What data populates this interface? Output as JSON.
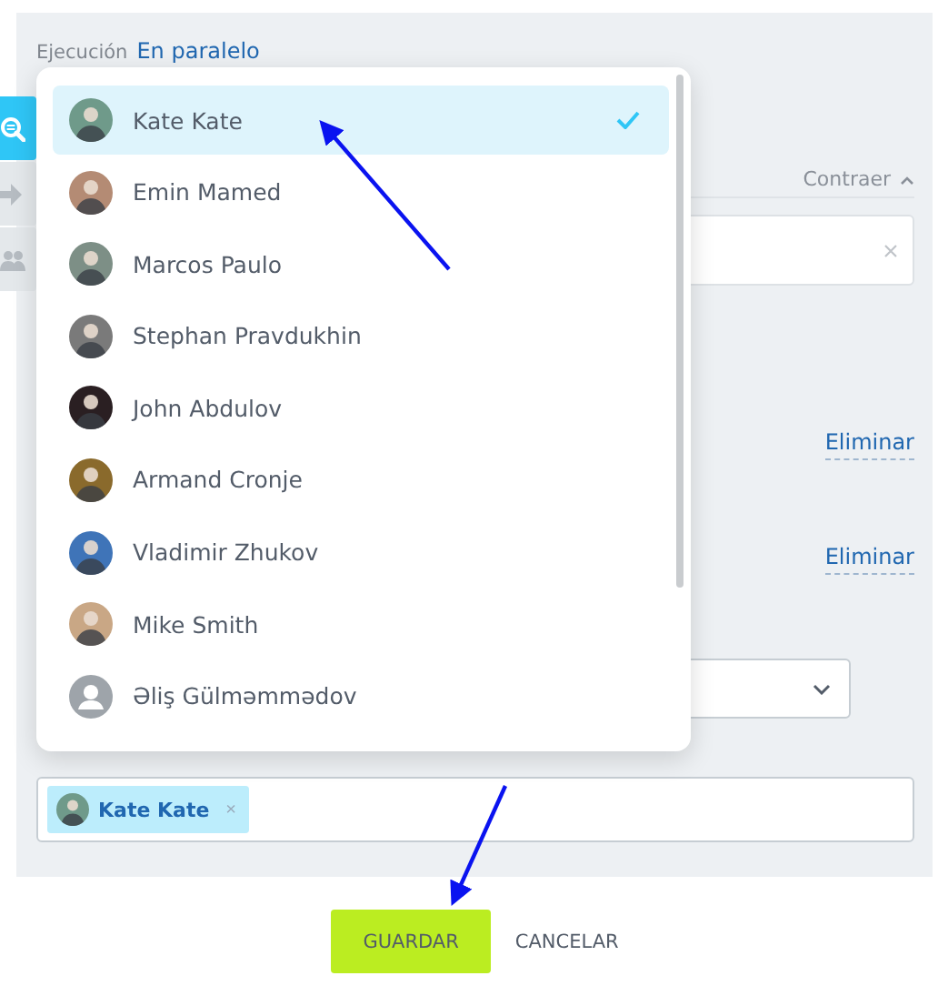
{
  "sidebar_tabs": [
    {
      "kind": "search",
      "selected": true
    },
    {
      "kind": "arrow",
      "selected": false
    },
    {
      "kind": "people",
      "selected": false
    }
  ],
  "execution": {
    "label": "Ejecución",
    "value": "En paralelo"
  },
  "collapse": {
    "label": "Contraer"
  },
  "remove_links": [
    "Eliminar",
    "Eliminar"
  ],
  "dropdown": {
    "items": [
      {
        "name": "Kate Kate",
        "kind": "photo",
        "selected": true
      },
      {
        "name": "Emin Mamed",
        "kind": "photo",
        "selected": false
      },
      {
        "name": "Marcos Paulo",
        "kind": "photo",
        "selected": false
      },
      {
        "name": "Stephan Pravdukhin",
        "kind": "photo",
        "selected": false
      },
      {
        "name": "John Abdulov",
        "kind": "photo",
        "selected": false
      },
      {
        "name": "Armand Cronje",
        "kind": "photo",
        "selected": false
      },
      {
        "name": "Vladimir Zhukov",
        "kind": "photo",
        "selected": false
      },
      {
        "name": "Mike Smith",
        "kind": "photo",
        "selected": false
      },
      {
        "name": "Əliş Gülməmmədov",
        "kind": "placeholder",
        "selected": false
      }
    ]
  },
  "assignee_field": {
    "chips": [
      {
        "name": "Kate Kate",
        "remove": "×"
      }
    ]
  },
  "buttons": [
    {
      "label": "GUARDAR",
      "kind": "primary"
    },
    {
      "label": "CANCELAR",
      "kind": "secondary"
    }
  ]
}
